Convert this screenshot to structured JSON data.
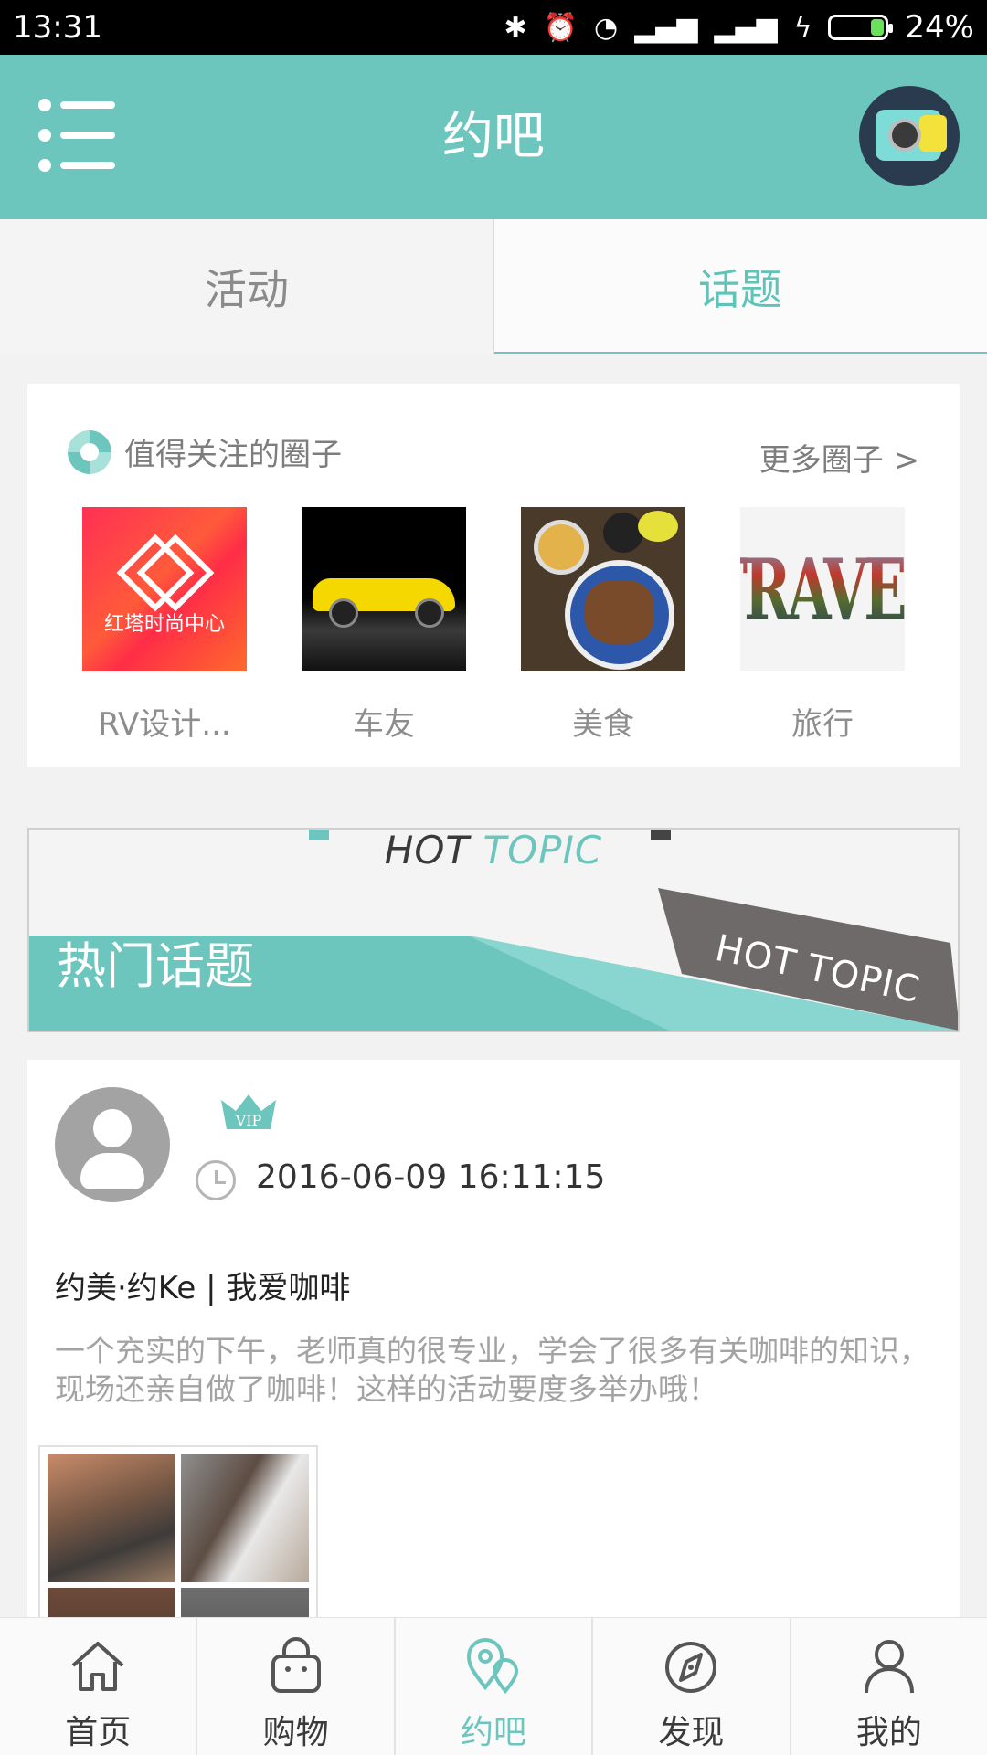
{
  "status_bar": {
    "time": "13:31",
    "battery": "24%",
    "battery_level": 0.24
  },
  "header": {
    "title": "约吧"
  },
  "tabs": [
    {
      "label": "活动",
      "active": false
    },
    {
      "label": "话题",
      "active": true
    }
  ],
  "circles": {
    "heading": "值得关注的圈子",
    "more": "更多圈子 >",
    "items": [
      {
        "label": "RV设计...",
        "logo_text": "红塔时尚中心"
      },
      {
        "label": "车友"
      },
      {
        "label": "美食"
      },
      {
        "label": "旅行",
        "image_text": "TRAVEL"
      }
    ]
  },
  "hot_topic": {
    "banner_prefix": "HOT",
    "banner_accent": "TOPIC",
    "label": "热门话题",
    "tag": "HOT TOPIC"
  },
  "post": {
    "badge": "VIP",
    "time": "2016-06-09 16:11:15",
    "title": "约美·约Ke | 我爱咖啡",
    "text": "一个充实的下午，老师真的很专业，学会了很多有关咖啡的知识，现场还亲自做了咖啡！这样的活动要度多举办哦！"
  },
  "bottom_nav": [
    {
      "label": "首页",
      "icon": "home-icon",
      "active": false
    },
    {
      "label": "购物",
      "icon": "shopping-bag-icon",
      "active": false
    },
    {
      "label": "约吧",
      "icon": "location-pins-icon",
      "active": true
    },
    {
      "label": "发现",
      "icon": "compass-icon",
      "active": false
    },
    {
      "label": "我的",
      "icon": "profile-icon",
      "active": false
    }
  ],
  "colors": {
    "accent": "#6cc6bd",
    "header": "#6cc6bd"
  }
}
